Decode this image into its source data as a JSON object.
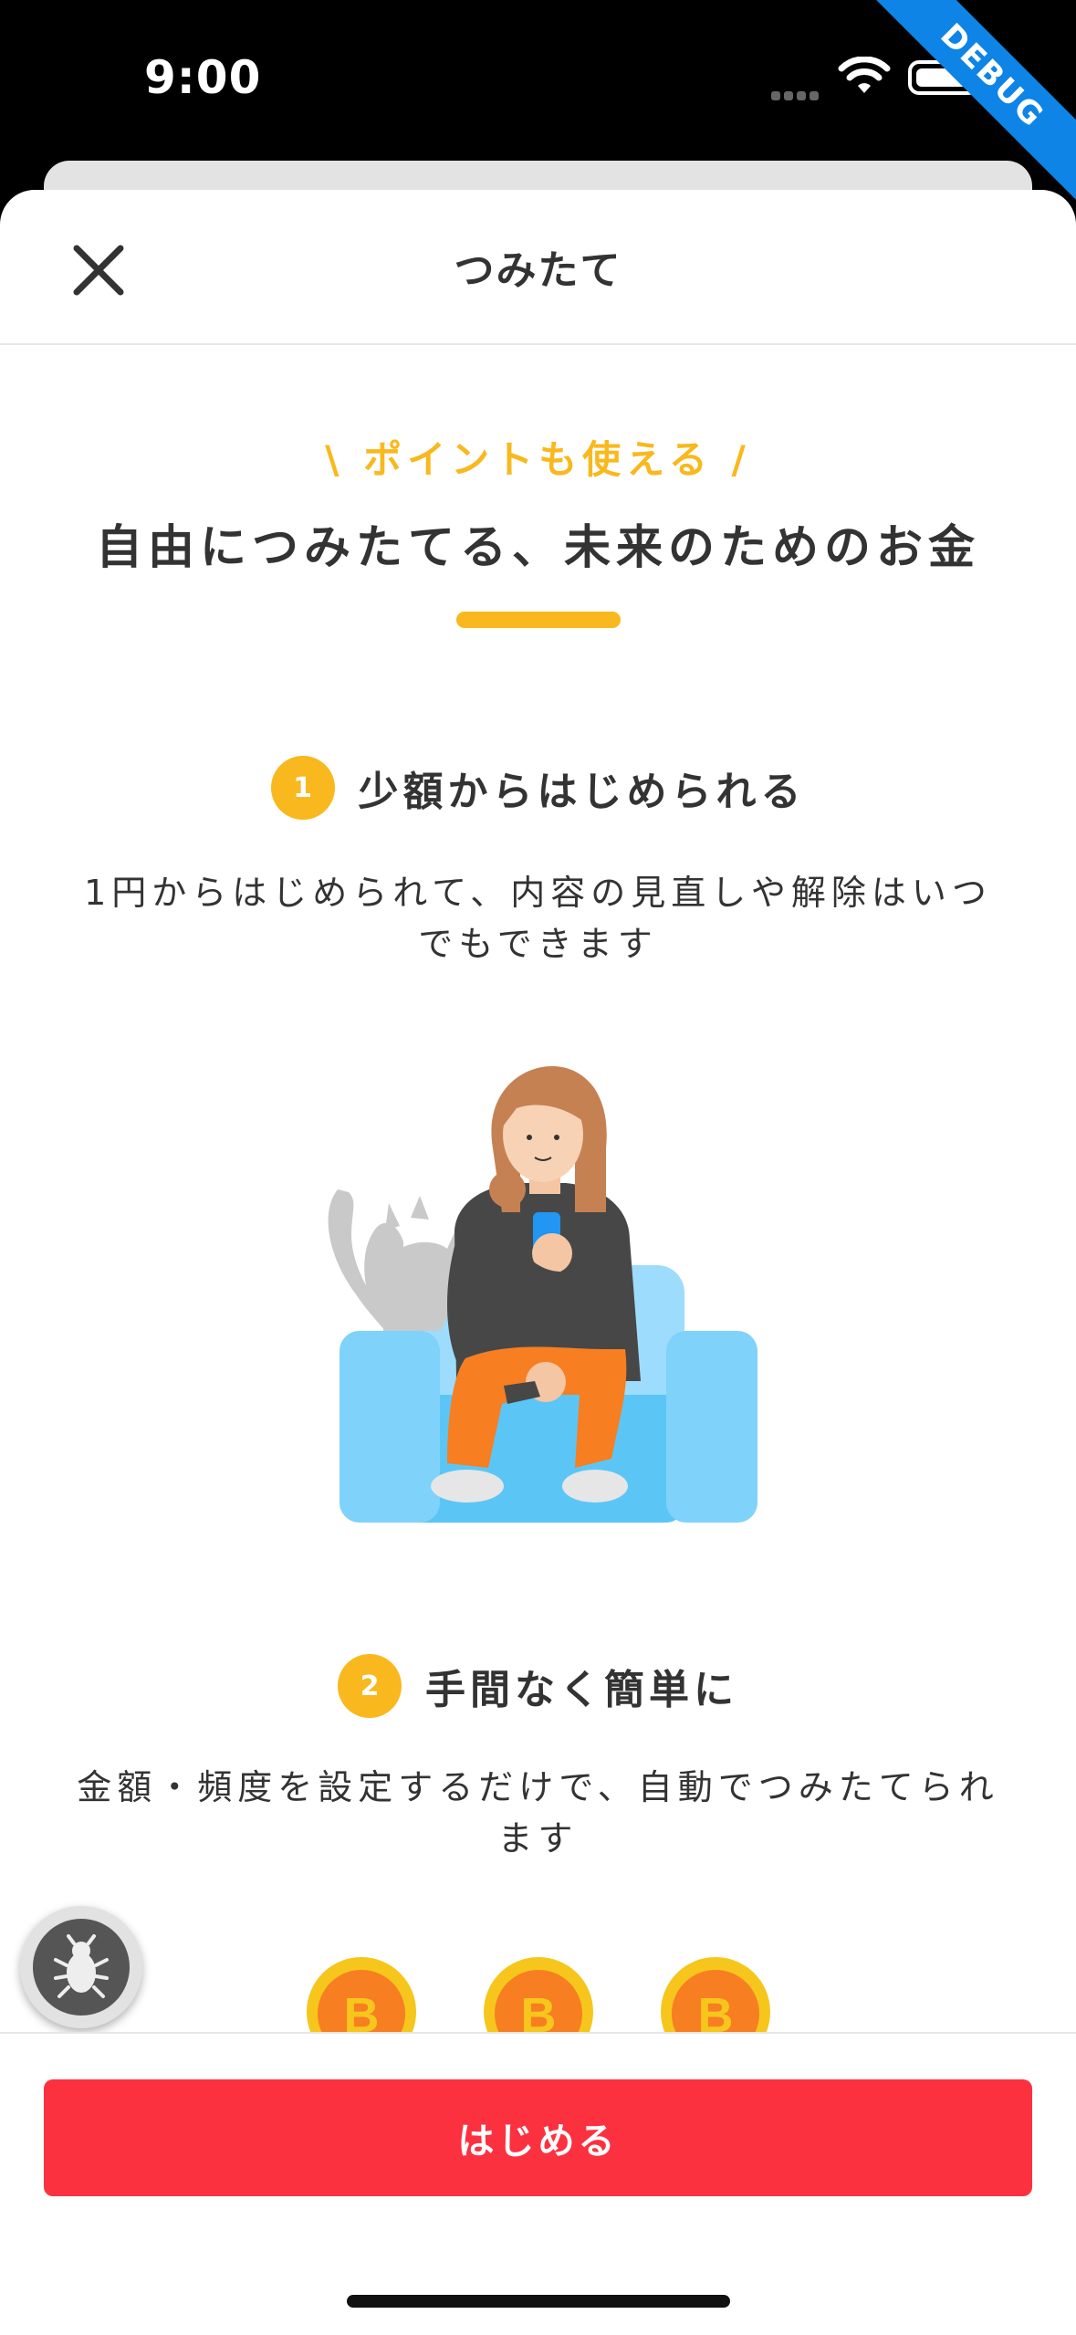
{
  "status_bar": {
    "time": "9:00",
    "debug_label": "DEBUG"
  },
  "header": {
    "title": "つみたて",
    "close_icon": "close-icon"
  },
  "intro": {
    "tagline": "\\ ポイントも使える /",
    "headline": "自由につみたてる、未来のためのお金"
  },
  "features": [
    {
      "number": "1",
      "title": "少額からはじめられる",
      "description_line1": "1円からはじめられて、内容の見直しや解除はいつ",
      "description_line2": "でもできます"
    },
    {
      "number": "2",
      "title": "手間なく簡単に",
      "description_line1": "金額・頻度を設定するだけで、自動でつみたてられ",
      "description_line2": "ます"
    }
  ],
  "coin_letter": "B",
  "cta": {
    "label": "はじめる"
  },
  "colors": {
    "accent": "#f9b81d",
    "primary_button": "#fc3140",
    "debug_banner": "#0d84e6"
  }
}
